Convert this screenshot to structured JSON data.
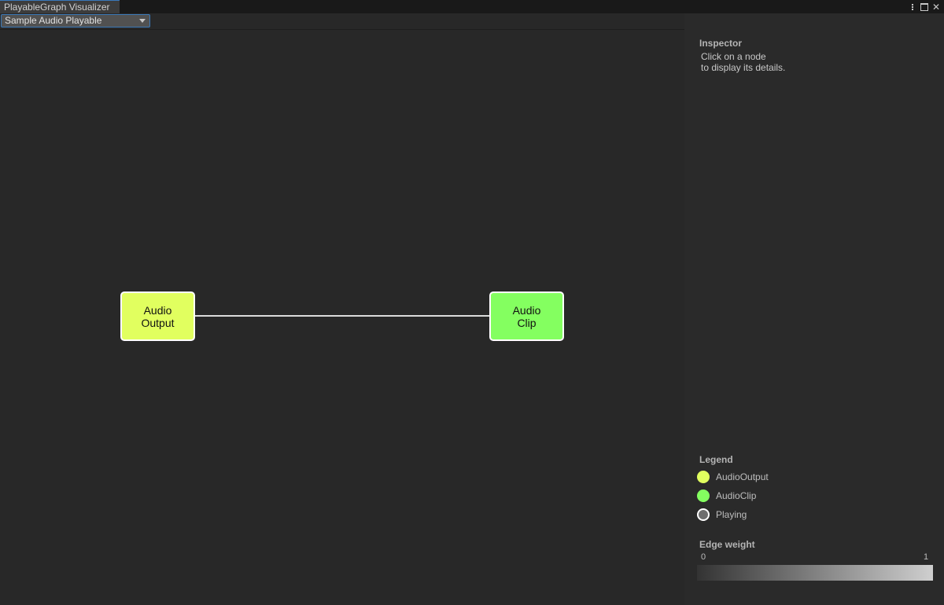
{
  "window": {
    "tab_title": "PlayableGraph Visualizer"
  },
  "toolbar": {
    "graph_select_value": "Sample Audio Playable"
  },
  "graph": {
    "nodes": [
      {
        "label": "Audio\nOutput",
        "type": "AudioOutput",
        "color": "#e1ff5f"
      },
      {
        "label": "Audio\nClip",
        "type": "AudioClip",
        "color": "#84ff60"
      }
    ],
    "edges": [
      {
        "from": "AudioOutput",
        "to": "AudioClip",
        "color": "#dcdcdc"
      }
    ]
  },
  "inspector": {
    "title": "Inspector",
    "text_line1": "Click on a node",
    "text_line2": "to display its details."
  },
  "legend": {
    "title": "Legend",
    "items": [
      {
        "label": "AudioOutput",
        "color": "#e1ff5f"
      },
      {
        "label": "AudioClip",
        "color": "#84ff60"
      },
      {
        "label": "Playing",
        "color": "#6e6e6e",
        "border": "#ffffff"
      }
    ]
  },
  "edge_weight": {
    "title": "Edge weight",
    "min_label": "0",
    "max_label": "1",
    "gradient_from": "#333333",
    "gradient_to": "#cfcfcf"
  },
  "icons": [
    "kebab-menu-icon",
    "maximize-icon",
    "close-icon",
    "chevron-down-icon"
  ]
}
